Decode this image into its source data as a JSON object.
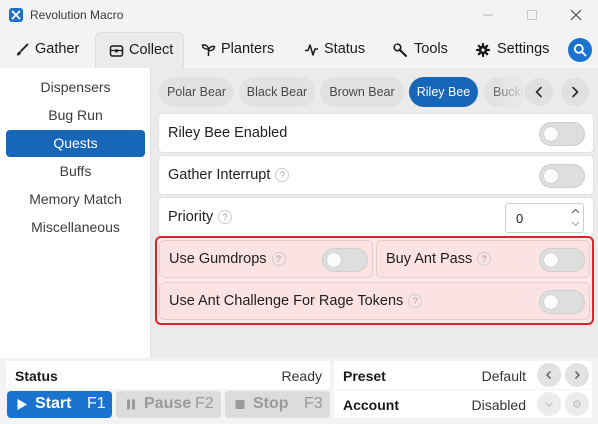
{
  "window": {
    "title": "Revolution Macro",
    "icon": "app-logo-icon",
    "controls": [
      "minimize-icon",
      "maximize-icon",
      "close-icon"
    ]
  },
  "main_tabs": [
    {
      "label": "Gather",
      "icon": "brush-icon",
      "active": false
    },
    {
      "label": "Collect",
      "icon": "chest-icon",
      "active": true
    },
    {
      "label": "Planters",
      "icon": "sprout-icon",
      "active": false
    },
    {
      "label": "Status",
      "icon": "pulse-icon",
      "active": false
    },
    {
      "label": "Tools",
      "icon": "wrench-icon",
      "active": false
    },
    {
      "label": "Settings",
      "icon": "gear-icon",
      "active": false
    }
  ],
  "search_icon": "search-icon",
  "sidebar": {
    "items": [
      {
        "label": "Dispensers",
        "active": false
      },
      {
        "label": "Bug Run",
        "active": false
      },
      {
        "label": "Quests",
        "active": true
      },
      {
        "label": "Buffs",
        "active": false
      },
      {
        "label": "Memory Match",
        "active": false
      },
      {
        "label": "Miscellaneous",
        "active": false
      }
    ]
  },
  "sub_tabs": {
    "items": [
      {
        "label": "Polar Bear",
        "active": false
      },
      {
        "label": "Black Bear",
        "active": false
      },
      {
        "label": "Brown Bear",
        "active": false
      },
      {
        "label": "Riley Bee",
        "active": true
      },
      {
        "label": "Bucko Bee",
        "active": false
      }
    ],
    "prev_icon": "chevron-left-icon",
    "next_icon": "chevron-right-icon"
  },
  "settings": {
    "riley_enabled": {
      "label": "Riley Bee Enabled",
      "on": false
    },
    "gather_interrupt": {
      "label": "Gather Interrupt",
      "help": "?",
      "on": false
    },
    "priority": {
      "label": "Priority",
      "help": "?",
      "value": "0"
    },
    "use_gumdrops": {
      "label": "Use Gumdrops",
      "help": "?",
      "on": false
    },
    "buy_ant_pass": {
      "label": "Buy Ant Pass",
      "help": "?",
      "on": false
    },
    "use_ant_challenge": {
      "label": "Use Ant Challenge For Rage Tokens",
      "help": "?",
      "on": false
    }
  },
  "status_bar": {
    "status_label": "Status",
    "status_value": "Ready",
    "preset_label": "Preset",
    "preset_value": "Default",
    "account_label": "Account",
    "account_value": "Disabled",
    "start": {
      "label": "Start",
      "key": "F1"
    },
    "pause": {
      "label": "Pause",
      "key": "F2"
    },
    "stop": {
      "label": "Stop",
      "key": "F3"
    }
  },
  "colors": {
    "accent": "#1766b8",
    "highlight_border": "#d7262f",
    "highlight_fill": "#fbe2e3"
  }
}
